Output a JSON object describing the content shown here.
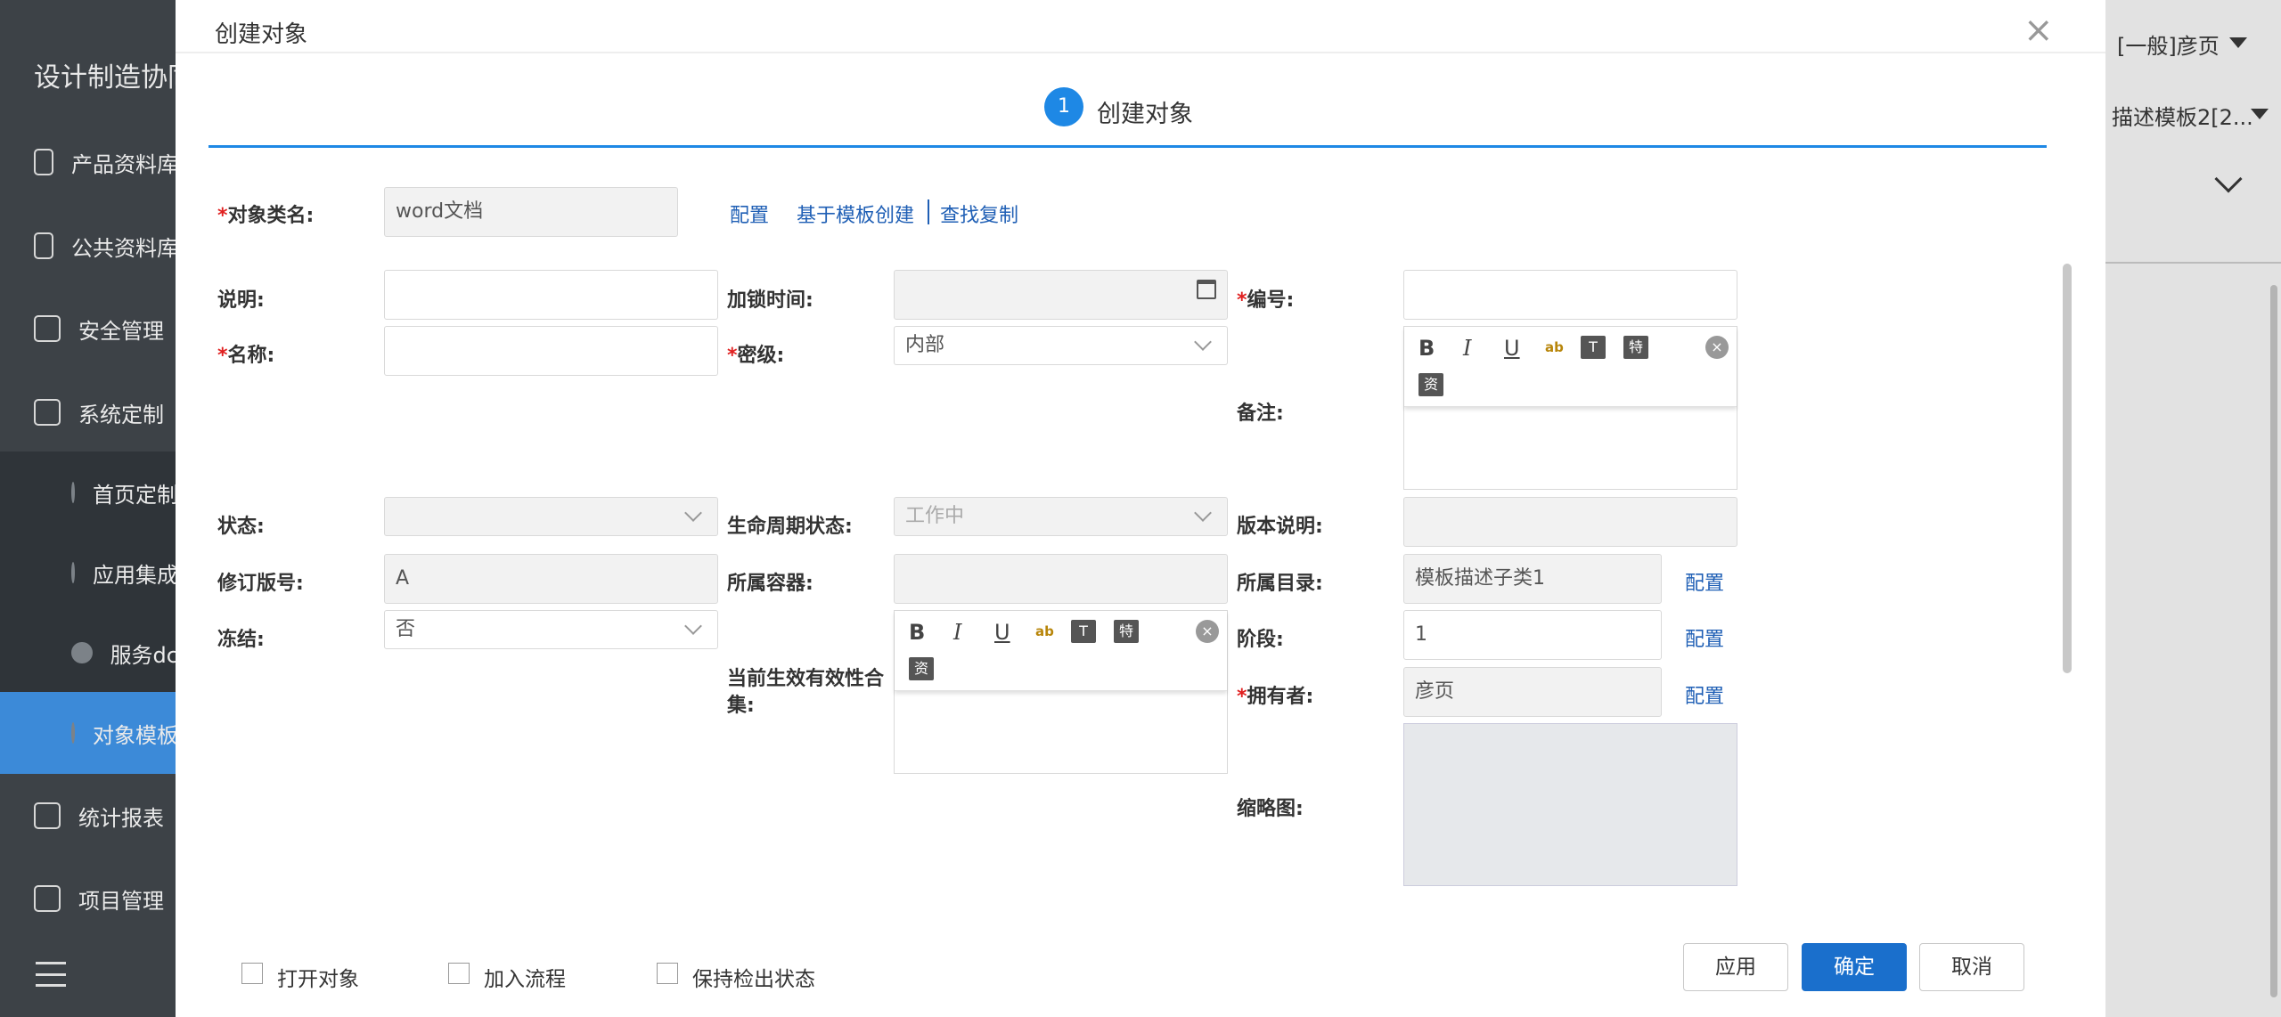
{
  "background": {
    "app_title": "设计制造协同",
    "nav": [
      {
        "label": "产品资料库"
      },
      {
        "label": "公共资料库"
      },
      {
        "label": "安全管理"
      },
      {
        "label": "系统定制"
      },
      {
        "label": "首页定制"
      },
      {
        "label": "应用集成"
      },
      {
        "label": "服务dc"
      },
      {
        "label": "对象模板"
      },
      {
        "label": "统计报表"
      },
      {
        "label": "项目管理"
      }
    ],
    "user": "[一般]彦页",
    "template_select": "描述模板2[2..."
  },
  "modal": {
    "title": "创建对象",
    "close": "×",
    "step": {
      "number": "1",
      "label": "创建对象"
    }
  },
  "form": {
    "object_class": {
      "label": "对象类名:",
      "value": "word文档"
    },
    "links": {
      "config": "配置",
      "from_template": "基于模板创建",
      "find_copy": "查找复制"
    },
    "description": {
      "label": "说明:",
      "value": ""
    },
    "lock_time": {
      "label": "加锁时间:",
      "value": ""
    },
    "number": {
      "label": "编号:",
      "value": ""
    },
    "name": {
      "label": "名称:",
      "value": ""
    },
    "security_level": {
      "label": "密级:",
      "value": "内部"
    },
    "remark": {
      "label": "备注:"
    },
    "status": {
      "label": "状态:",
      "value": ""
    },
    "lifecycle_status": {
      "label": "生命周期状态:",
      "value": "工作中"
    },
    "version_note": {
      "label": "版本说明:",
      "value": ""
    },
    "revision": {
      "label": "修订版号:",
      "value": "A"
    },
    "container": {
      "label": "所属容器:",
      "value": ""
    },
    "directory": {
      "label": "所属目录:",
      "value": "模板描述子类1",
      "config": "配置"
    },
    "frozen": {
      "label": "冻结:",
      "value": "否"
    },
    "effectivity": {
      "label_line1": "当前生效有效性合",
      "label_line2": "集:"
    },
    "stage": {
      "label": "阶段:",
      "value": "1",
      "config": "配置"
    },
    "owner": {
      "label": "拥有者:",
      "value": "彦页",
      "config": "配置"
    },
    "thumbnail": {
      "label": "缩略图:"
    }
  },
  "editor_toolbar": {
    "bold": "B",
    "italic": "I",
    "underline": "U",
    "spell": "ab",
    "text": "T",
    "special": "特",
    "resource": "资",
    "clear": "×"
  },
  "footer": {
    "open_object": "打开对象",
    "add_flow": "加入流程",
    "keep_checkout": "保持检出状态",
    "apply": "应用",
    "ok": "确定",
    "cancel": "取消"
  },
  "colors": {
    "accent": "#1e88e5",
    "primary_button": "#1a6fcc",
    "link": "#1f5fb5",
    "required": "#e02020",
    "sidebar_active": "#3c8ad8"
  }
}
